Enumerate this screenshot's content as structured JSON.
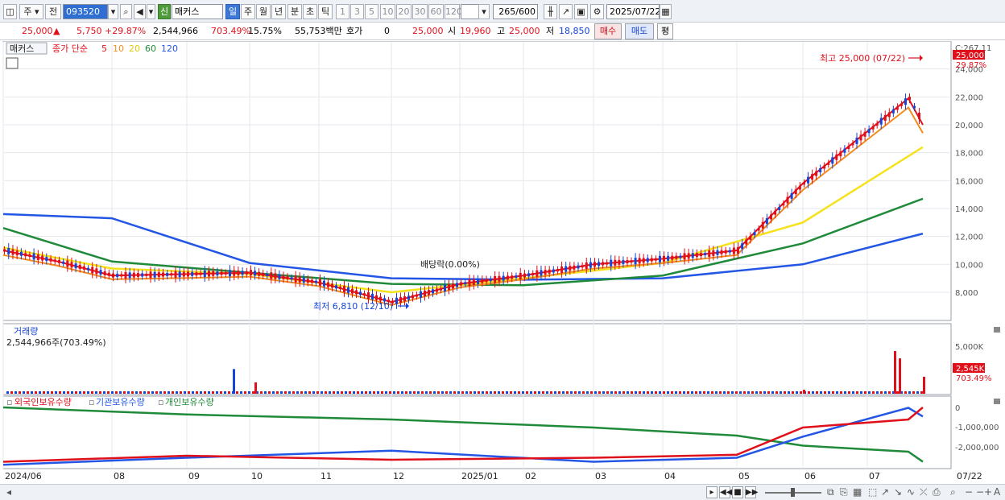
{
  "toolbar": {
    "period_main": "주",
    "period_prev": "전",
    "code": "093520",
    "new_badge": "신",
    "stock_name": "매커스",
    "periods": [
      "일",
      "주",
      "월",
      "년",
      "분",
      "초",
      "틱"
    ],
    "intervals": [
      "1",
      "3",
      "5",
      "10",
      "20",
      "30",
      "60",
      "120"
    ],
    "count": "265",
    "count_max": "/600",
    "date": "2025/07/22"
  },
  "quote": {
    "price": "25,000",
    "change": "5,750",
    "change_pct": "+29.87%",
    "volume": "2,544,966",
    "volume_ratio": "703.49%",
    "turnover": "15.75%",
    "amount": "55,753백만",
    "hoga_label": "호가",
    "hoga_value": "0",
    "ask_price": "25,000",
    "open_label": "시",
    "open_value": "19,960",
    "high_label": "고",
    "high_value": "25,000",
    "low_label": "저",
    "low_value": "18,850",
    "buy_label": "매수",
    "sell_label": "매도",
    "avg_label": "평"
  },
  "price_panel": {
    "stock_tag": "매커스",
    "legend_prefix": "종가 단순",
    "ma_periods": [
      "5",
      "10",
      "20",
      "60",
      "120"
    ],
    "ma_colors": [
      "#e0101b",
      "#f28c1e",
      "#f5e21a",
      "#1f8a3a",
      "#2456e6"
    ],
    "c_value": "C:267.11",
    "current_price_tag": "25,000",
    "current_pct_tag": "29.87%",
    "y_ticks": [
      "24,000",
      "22,000",
      "20,000",
      "18,000",
      "16,000",
      "14,000",
      "12,000",
      "10,000",
      "8,000"
    ],
    "high_annotation": "최고 25,000 (07/22)",
    "low_annotation": "최저 6,810 (12/10)",
    "dividend_annotation": "배당락(0.00%)"
  },
  "volume_panel": {
    "title": "거래량",
    "value_text": "2,544,966주(703.49%)",
    "y_tick": "5,000K",
    "current_tag": "2,545K",
    "current_pct_tag": "703.49%"
  },
  "holding_panel": {
    "legend": [
      "외국인보유수량",
      "기관보유수량",
      "개인보유수량"
    ],
    "legend_colors": [
      "#e0101b",
      "#2456e6",
      "#1f8a3a"
    ],
    "y_ticks": [
      "0",
      "-1,000,000",
      "-2,000,000"
    ]
  },
  "x_axis": {
    "labels": [
      "2024/06",
      "08",
      "09",
      "10",
      "11",
      "12",
      "2025/01",
      "02",
      "03",
      "04",
      "05",
      "06",
      "07"
    ],
    "right_label": "07/22"
  },
  "chart_data": [
    {
      "type": "line",
      "title": "",
      "series": [
        {
          "name": "5",
          "x": [
            "2024/06",
            "2024/07",
            "2024/08",
            "2024/09",
            "2024/10",
            "2024/11",
            "2024/12",
            "2025/01",
            "2025/02",
            "2025/03",
            "2025/04",
            "2025/05",
            "2025/06",
            "2025/07/10",
            "2025/07/22"
          ],
          "values": [
            11000,
            10200,
            9200,
            9300,
            9400,
            8700,
            7300,
            8600,
            9200,
            10000,
            10400,
            11000,
            15800,
            21900,
            20000
          ]
        },
        {
          "name": "20",
          "x": [
            "2024/06",
            "2024/08",
            "2024/10",
            "2024/12",
            "2025/02",
            "2025/04",
            "2025/06",
            "2025/07/22"
          ],
          "values": [
            11200,
            9700,
            9300,
            8000,
            9000,
            10100,
            13000,
            18400
          ]
        },
        {
          "name": "60",
          "x": [
            "2024/06",
            "2024/08",
            "2024/10",
            "2024/12",
            "2025/02",
            "2025/04",
            "2025/06",
            "2025/07/22"
          ],
          "values": [
            12600,
            10200,
            9400,
            8600,
            8500,
            9200,
            11500,
            14700
          ]
        },
        {
          "name": "120",
          "x": [
            "2024/06",
            "2024/08",
            "2024/10",
            "2024/12",
            "2025/02",
            "2025/04",
            "2025/06",
            "2025/07/22"
          ],
          "values": [
            13600,
            13300,
            10100,
            9000,
            8900,
            9000,
            10000,
            12200
          ]
        }
      ],
      "ylim": [
        6000,
        26000
      ],
      "annotations": [
        "최고 25,000 (07/22)",
        "최저 6,810 (12/10)",
        "배당락(0.00%)"
      ]
    },
    {
      "type": "bar",
      "title": "거래량",
      "categories": [
        "2024/09",
        "2024/10",
        "2025/06",
        "2025/07/08",
        "2025/07/09",
        "2025/07/22"
      ],
      "values": [
        3700,
        1700,
        600,
        6400,
        5300,
        2545
      ],
      "ylim": [
        0,
        7000
      ]
    },
    {
      "type": "line",
      "series": [
        {
          "name": "외국인보유수량",
          "x": [
            "2024/06",
            "2024/09",
            "2024/12",
            "2025/03",
            "2025/05",
            "2025/06",
            "2025/07/10",
            "2025/07/22"
          ],
          "values": [
            -2700000,
            -2400000,
            -2600000,
            -2500000,
            -2350000,
            -1000000,
            -600000,
            0
          ]
        },
        {
          "name": "기관보유수량",
          "x": [
            "2024/06",
            "2024/09",
            "2024/12",
            "2025/03",
            "2025/05",
            "2025/06",
            "2025/07/10",
            "2025/07/22"
          ],
          "values": [
            -2850000,
            -2500000,
            -2150000,
            -2700000,
            -2500000,
            -1450000,
            -20000,
            -450000
          ]
        },
        {
          "name": "개인보유수량",
          "x": [
            "2024/06",
            "2024/09",
            "2024/12",
            "2025/03",
            "2025/05",
            "2025/06",
            "2025/07/10",
            "2025/07/22"
          ],
          "values": [
            0,
            -350000,
            -600000,
            -1000000,
            -1400000,
            -1900000,
            -2200000,
            -2700000
          ]
        }
      ],
      "ylim": [
        -3000000,
        300000
      ]
    }
  ]
}
